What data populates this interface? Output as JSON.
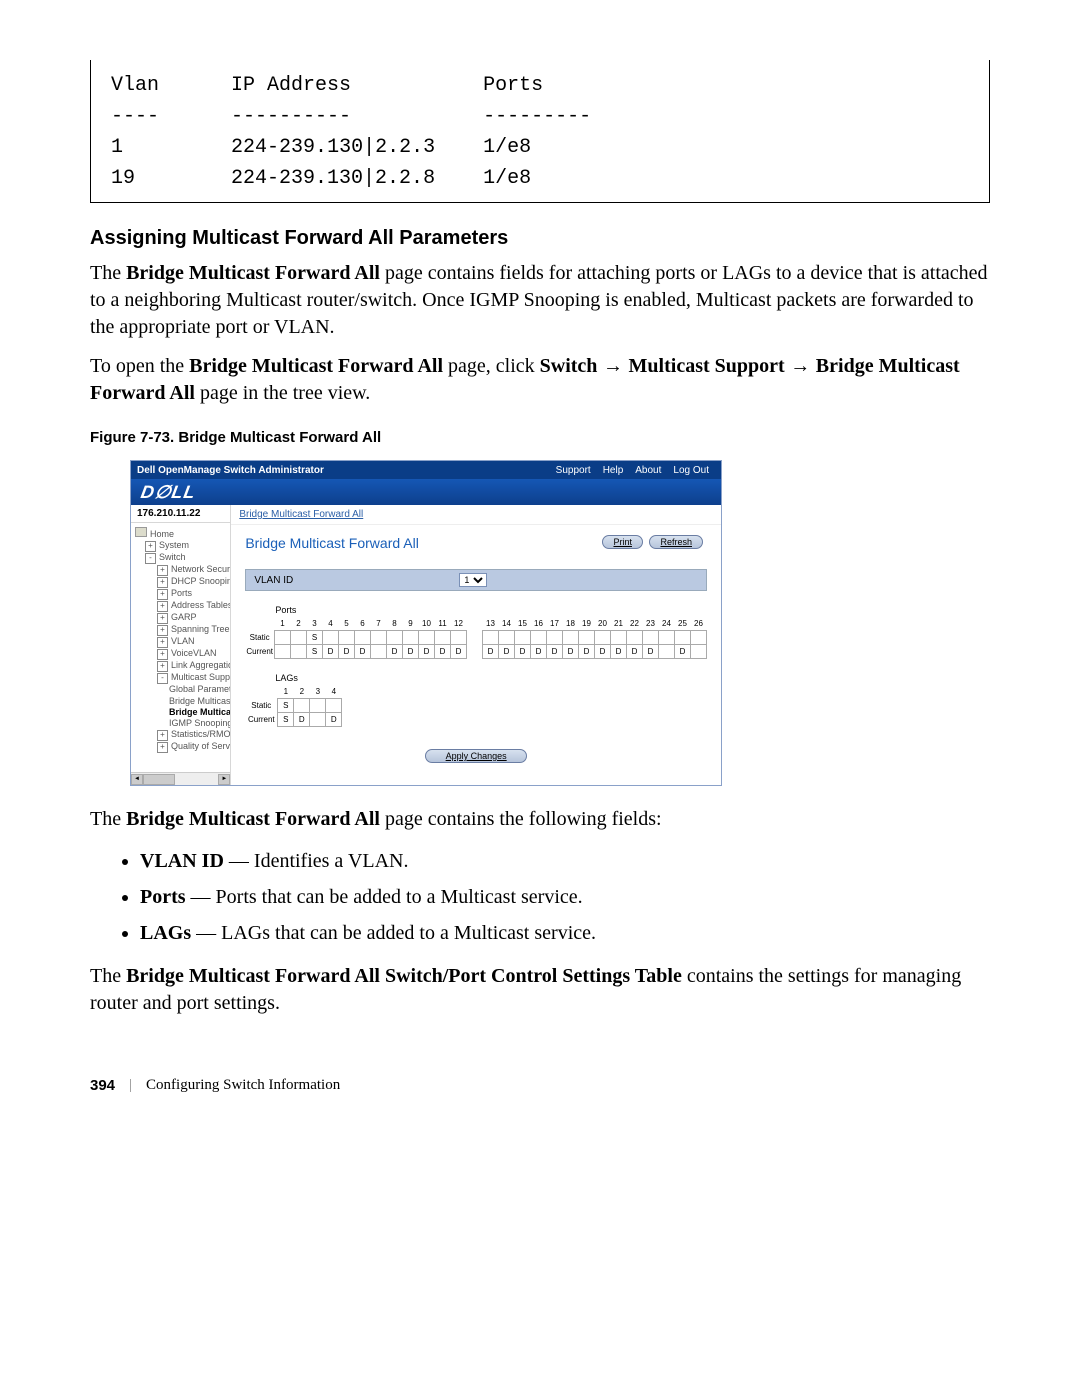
{
  "cli": {
    "headers": {
      "c1": "Vlan",
      "c2": "IP Address",
      "c3": "Ports"
    },
    "divs": {
      "c1": "----",
      "c2": "----------",
      "c3": "---------"
    },
    "row1": {
      "c1": "1",
      "c2": "224-239.130|2.2.3",
      "c3": "1/e8"
    },
    "row2": {
      "c1": "19",
      "c2": "224-239.130|2.2.8",
      "c3": "1/e8"
    }
  },
  "heading": "Assigning Multicast Forward All Parameters",
  "para1": {
    "t1": "The ",
    "b1": "Bridge Multicast Forward All",
    "t2": " page contains fields for attaching ports or LAGs to a device that is attached to a neighboring Multicast router/switch. Once IGMP Snooping is enabled, Multicast packets are forwarded to the appropriate port or VLAN."
  },
  "para2": {
    "t1": "To open the ",
    "b1": "Bridge Multicast Forward All",
    "t2": " page, click ",
    "b2": "Switch",
    "a1": " → ",
    "b3": "Multicast Support",
    "a2": " → ",
    "b4": "Bridge Multicast Forward All",
    "t3": " page in the tree view."
  },
  "figcap": "Figure 7-73.   Bridge Multicast Forward All",
  "screenshot": {
    "title": "Dell OpenManage Switch Administrator",
    "toolbar": {
      "support": "Support",
      "help": "Help",
      "about": "About",
      "logout": "Log Out"
    },
    "ip": "176.210.11.22",
    "breadcrumb": "Bridge Multicast Forward All",
    "content_title": "Bridge Multicast Forward All",
    "print_btn": "Print",
    "refresh_btn": "Refresh",
    "vlan_label": "VLAN ID",
    "vlan_value": "1",
    "ports_label": "Ports",
    "static_label": "Static",
    "current_label": "Current",
    "lags_label": "LAGs",
    "apply_btn": "Apply Changes",
    "port_cols_a": [
      "1",
      "2",
      "3",
      "4",
      "5",
      "6",
      "7",
      "8",
      "9",
      "10",
      "11",
      "12"
    ],
    "port_cols_b": [
      "13",
      "14",
      "15",
      "16",
      "17",
      "18",
      "19",
      "20",
      "21",
      "22",
      "23",
      "24",
      "25",
      "26"
    ],
    "ports_static": [
      "",
      "",
      "S",
      "",
      "",
      "",
      "",
      "",
      "",
      "",
      "",
      ""
    ],
    "ports_current_a": [
      "",
      "",
      "S",
      "D",
      "D",
      "D",
      "",
      "D",
      "D",
      "D",
      "D",
      "D"
    ],
    "ports_current_b": [
      "D",
      "D",
      "D",
      "D",
      "D",
      "D",
      "D",
      "D",
      "D",
      "D",
      "D",
      "",
      "D",
      ""
    ],
    "lag_cols": [
      "1",
      "2",
      "3",
      "4"
    ],
    "lags_static": [
      "S",
      "",
      "",
      ""
    ],
    "lags_current": [
      "S",
      "D",
      "",
      "D"
    ],
    "tree": {
      "home": "Home",
      "system": "System",
      "switch": "Switch",
      "netsec": "Network Security",
      "dhcp": "DHCP Snooping",
      "ports": "Ports",
      "addr": "Address Tables",
      "garp": "GARP",
      "spanning": "Spanning Tree",
      "vlan": "VLAN",
      "voicevlan": "VoiceVLAN",
      "linkagg": "Link Aggregation",
      "mcast": "Multicast Support",
      "global": "Global Parameter",
      "bmc": "Bridge Multicast (",
      "bmcfa": "Bridge Multicast",
      "igmp": "IGMP Snooping",
      "stats": "Statistics/RMON",
      "qos": "Quality of Service"
    }
  },
  "para3": {
    "t1": "The ",
    "b1": "Bridge Multicast Forward All",
    "t2": " page contains the following fields:"
  },
  "bullets": {
    "b1head": "VLAN ID",
    "b1tail": " — Identifies a VLAN.",
    "b2head": "Ports",
    "b2tail": " — Ports that can be added to a Multicast service.",
    "b3head": "LAGs",
    "b3tail": " — LAGs that can be added to a Multicast service."
  },
  "para4": {
    "t1": "The ",
    "b1": "Bridge Multicast Forward All Switch/Port Control Settings Table",
    "t2": " contains the settings for managing router and port settings."
  },
  "footer": {
    "page": "394",
    "chapter": "Configuring Switch Information"
  }
}
